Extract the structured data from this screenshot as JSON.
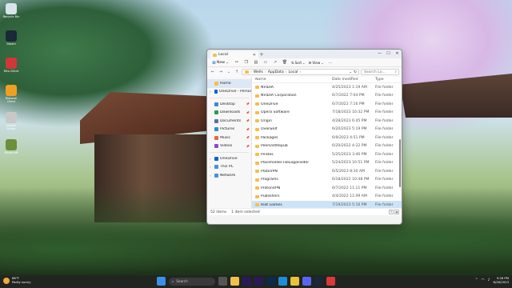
{
  "desktop": {
    "icons": [
      {
        "label": "Recycle Bin",
        "color": "#d9e3ea"
      },
      {
        "label": "Steam",
        "color": "#1b2838"
      },
      {
        "label": "Rito Client",
        "color": "#d13639"
      },
      {
        "label": "Ristovel Client",
        "color": "#f0a020"
      },
      {
        "label": "Create Folder",
        "color": "#c8c8c8"
      },
      {
        "label": "Minecraft",
        "color": "#6b8f3a"
      }
    ]
  },
  "explorer": {
    "tab_title": "Local",
    "toolbar": {
      "new_label": "New",
      "sort_label": "Sort",
      "view_label": "View",
      "more_label": "..."
    },
    "breadcrumb": [
      "Wells",
      "AppData",
      "Local"
    ],
    "search_placeholder": "Search Lo...",
    "nav": {
      "top": [
        {
          "label": "Home",
          "color": "#f2c04a",
          "selected": true
        },
        {
          "label": "OneDrive - Personal",
          "color": "#0a64c8"
        }
      ],
      "pinned": [
        {
          "label": "Desktop",
          "color": "#3a88d8"
        },
        {
          "label": "Downloads",
          "color": "#2b9a5a"
        },
        {
          "label": "Documents",
          "color": "#5a6fa8"
        },
        {
          "label": "Pictures",
          "color": "#2a8fd0"
        },
        {
          "label": "Music",
          "color": "#e06b3a"
        },
        {
          "label": "Videos",
          "color": "#8a4ad0"
        }
      ],
      "bottom": [
        {
          "label": "OneDrive",
          "color": "#0a64c8"
        },
        {
          "label": "This PC",
          "color": "#4a90d9"
        },
        {
          "label": "Network",
          "color": "#4a90d9"
        }
      ]
    },
    "columns": {
      "name": "Name",
      "date": "Date modified",
      "type": "Type"
    },
    "rows": [
      {
        "name": "NVIDIA",
        "date": "4/25/2023 1:19 AM",
        "type": "File folder"
      },
      {
        "name": "NVIDIA Corporation",
        "date": "6/7/2022 7:04 PM",
        "type": "File folder"
      },
      {
        "name": "OneDrive",
        "date": "6/7/2022 7:16 PM",
        "type": "File folder"
      },
      {
        "name": "Opera Software",
        "date": "7/18/2023 10:32 PM",
        "type": "File folder"
      },
      {
        "name": "Origin",
        "date": "4/28/2023 6:45 PM",
        "type": "File folder"
      },
      {
        "name": "Overwolf",
        "date": "6/20/2023 5:19 PM",
        "type": "File folder"
      },
      {
        "name": "Packages",
        "date": "6/9/2023 4:51 PM",
        "type": "File folder"
      },
      {
        "name": "PeerDistRepub",
        "date": "6/20/2022 4:22 PM",
        "type": "File folder"
      },
      {
        "name": "Pirates",
        "date": "5/25/2023 3:46 PM",
        "type": "File folder"
      },
      {
        "name": "PlaceholderTileLogoFolder",
        "date": "5/24/2023 10:51 PM",
        "type": "File folder"
      },
      {
        "name": "PlatoVPN",
        "date": "6/5/2023 8:30 AM",
        "type": "File folder"
      },
      {
        "name": "Programs",
        "date": "6/18/2022 10:48 PM",
        "type": "File folder"
      },
      {
        "name": "ProtonVPN",
        "date": "6/7/2022 11:11 PM",
        "type": "File folder"
      },
      {
        "name": "Publishers",
        "date": "4/4/2022 11:09 AM",
        "type": "File folder"
      },
      {
        "name": "Riot Games",
        "date": "7/19/2023 5:16 PM",
        "type": "File folder",
        "selected": true
      },
      {
        "name": "",
        "date": "",
        "type": "File folder"
      }
    ],
    "status": {
      "count": "52 items",
      "selected": "1 item selected"
    }
  },
  "taskbar": {
    "weather_temp": "86°F",
    "weather_desc": "Partly sunny",
    "search_label": "Search",
    "apps": [
      {
        "name": "start-icon",
        "color": "#3a8fe8"
      },
      {
        "name": "taskview-icon",
        "color": "#555"
      },
      {
        "name": "explorer-icon",
        "color": "#f2c04a"
      },
      {
        "name": "premiere-icon",
        "color": "#2a1a5a"
      },
      {
        "name": "aftereffects-icon",
        "color": "#2a1a5a"
      },
      {
        "name": "photoshop-icon",
        "color": "#0c2a4a"
      },
      {
        "name": "edge-icon",
        "color": "#1a8fd8"
      },
      {
        "name": "chrome-icon",
        "color": "#e8c23a"
      },
      {
        "name": "discord-icon",
        "color": "#5865f2"
      },
      {
        "name": "steam-icon",
        "color": "#1b2838"
      },
      {
        "name": "game-icon",
        "color": "#d83a3a"
      }
    ],
    "time": "5:26 PM",
    "date": "6/26/2023"
  }
}
